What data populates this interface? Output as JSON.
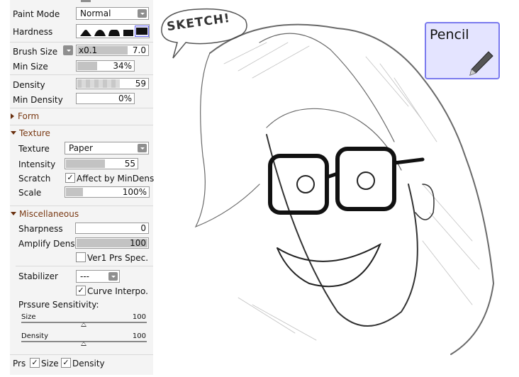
{
  "panel": {
    "paint_mode": {
      "label": "Paint Mode",
      "value": "Normal"
    },
    "hardness": {
      "label": "Hardness",
      "selected_index": 4,
      "levels": 5
    },
    "brush_size": {
      "label": "Brush Size",
      "multiplier": "x0.1",
      "value": "7.0",
      "fill": 0.6
    },
    "min_size": {
      "label": "Min Size",
      "value": "34%",
      "fill": 0.34
    },
    "density": {
      "label": "Density",
      "value": "59",
      "fill": 0.59
    },
    "min_density": {
      "label": "Min Density",
      "value": "0%",
      "fill": 0
    },
    "form": {
      "label": "Form",
      "expanded": false
    },
    "texture_section": {
      "label": "Texture",
      "expanded": true
    },
    "texture": {
      "label": "Texture",
      "value": "Paper"
    },
    "intensity": {
      "label": "Intensity",
      "value": "55",
      "fill": 0.55
    },
    "scratch": {
      "label": "Scratch",
      "checkbox_label": "Affect by MinDens",
      "checked": true
    },
    "scale": {
      "label": "Scale",
      "value": "100%",
      "fill": 0.2
    },
    "misc_section": {
      "label": "Miscellaneous",
      "expanded": true
    },
    "sharpness": {
      "label": "Sharpness",
      "value": "0"
    },
    "amplify": {
      "label": "Amplify Dens.",
      "value": "100",
      "fill": 1
    },
    "ver1": {
      "label": "Ver1 Prs Spec.",
      "checked": false
    },
    "stabilizer": {
      "label": "Stabilizer",
      "value": "---"
    },
    "curve": {
      "label": "Curve Interpo.",
      "checked": true
    },
    "pressure": {
      "label": "Prssure Sensitivity:",
      "size_label": "Size",
      "size_value": "100",
      "density_label": "Density",
      "density_value": "100"
    },
    "prs": {
      "label": "Prs",
      "size": "Size",
      "density": "Density",
      "check": "✓"
    }
  },
  "canvas": {
    "speech_bubble": "SKETCH!"
  },
  "tool_badge": {
    "label": "Pencil"
  },
  "colors": {
    "section": "#7a3a14",
    "badge_bg": "#e4e4ff",
    "badge_border": "#7a7aee"
  }
}
